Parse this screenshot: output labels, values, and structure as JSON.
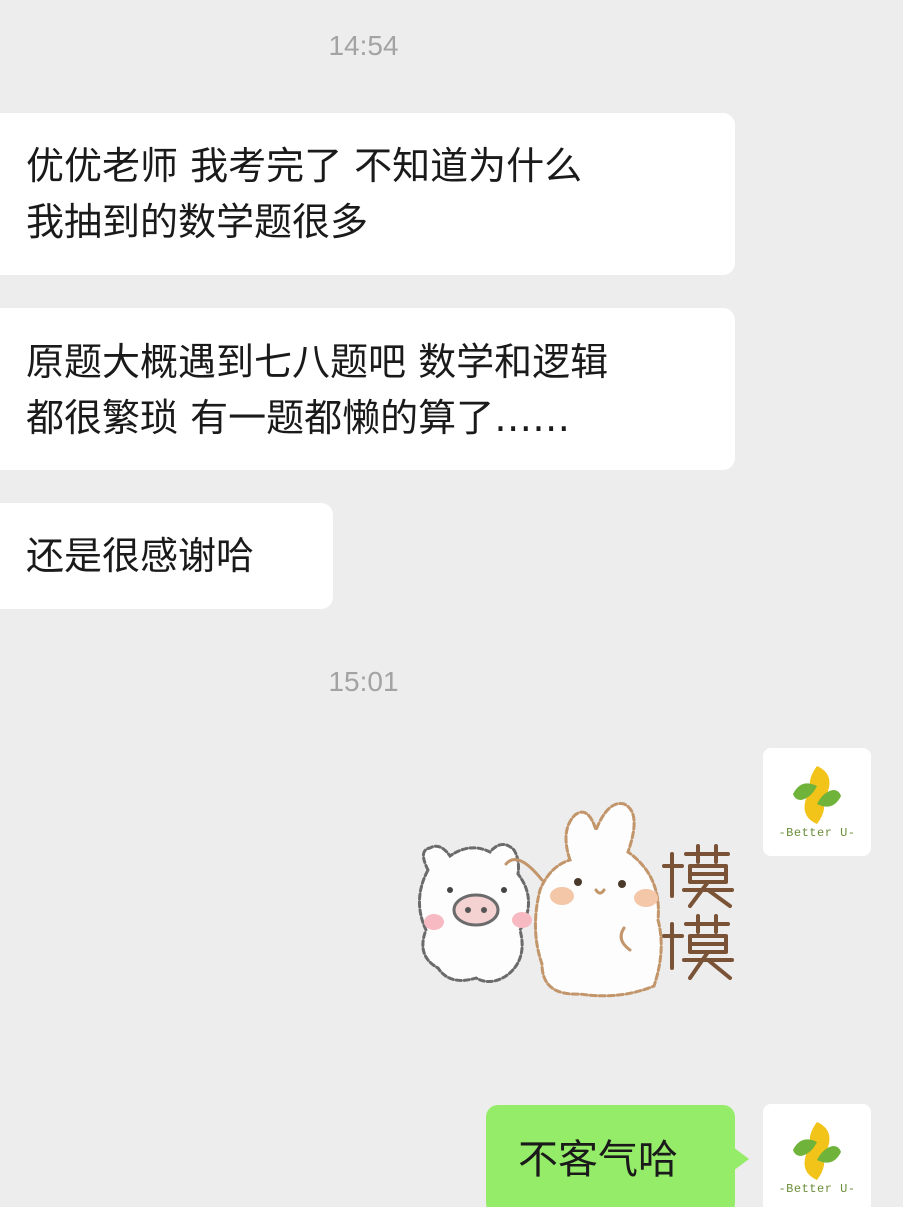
{
  "timestamps": [
    "14:54",
    "15:01"
  ],
  "messages_received": [
    {
      "lines": [
        "优优老师 我考完了 不知道为什么",
        "我抽到的数学题很多"
      ]
    },
    {
      "lines": [
        "原题大概遇到七八题吧 数学和逻辑",
        "都很繁琐 有一题都懒的算了……"
      ]
    },
    {
      "lines": [
        "还是很感谢哈"
      ]
    }
  ],
  "sticker": {
    "text_chars": [
      "摸",
      "摸"
    ],
    "icon": "pig-and-bunny-sticker"
  },
  "message_sent": {
    "text": "不客气哈"
  },
  "avatar": {
    "caption": "-Better U-",
    "icon": "better-u-logo-icon"
  },
  "colors": {
    "background": "#ededed",
    "received_bubble": "#ffffff",
    "sent_bubble": "#95ec69",
    "timestamp": "#a3a3a3"
  }
}
